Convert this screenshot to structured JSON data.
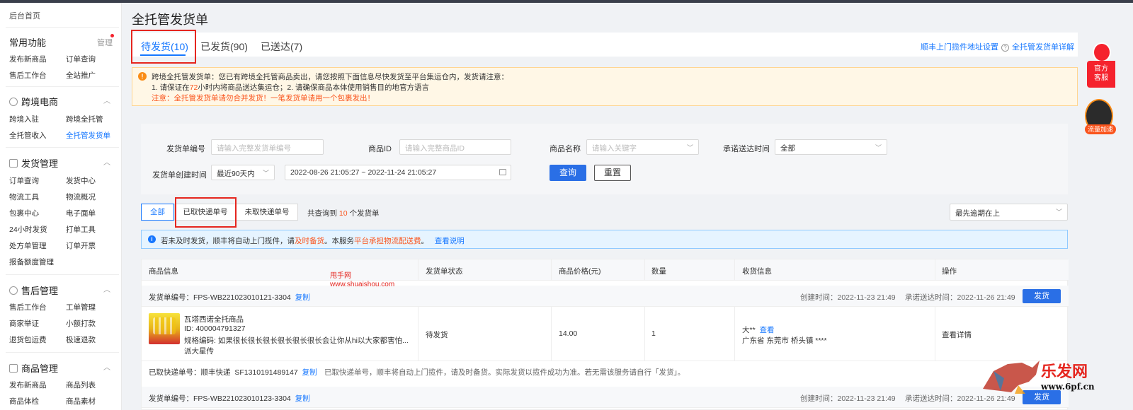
{
  "sidebar": {
    "home": "后台首页",
    "common": {
      "title": "常用功能",
      "manage": "管理",
      "items": [
        "发布新商品",
        "订单查询",
        "售后工作台",
        "全站推广"
      ]
    },
    "crossborder": {
      "title": "跨境电商",
      "items": [
        "跨境入驻",
        "跨境全托管",
        "全托管收入",
        "全托管发货单"
      ]
    },
    "shipping": {
      "title": "发货管理",
      "items": [
        "订单查询",
        "发货中心",
        "物流工具",
        "物流概况",
        "包裹中心",
        "电子面单",
        "24小时发货",
        "打单工具",
        "处方单管理",
        "订单开票",
        "报备额度管理"
      ]
    },
    "aftersale": {
      "title": "售后管理",
      "items": [
        "售后工作台",
        "工单管理",
        "商家举证",
        "小额打款",
        "退货包运费",
        "极速退款"
      ]
    },
    "goods": {
      "title": "商品管理",
      "items": [
        "发布新商品",
        "商品列表",
        "商品体检",
        "商品素材"
      ]
    }
  },
  "page": {
    "title": "全托管发货单",
    "tabs": [
      "待发货(10)",
      "已发货(90)",
      "已送达(7)"
    ],
    "links": [
      "顺丰上门揽件地址设置",
      "全托管发货单详解"
    ]
  },
  "notice": {
    "line1": "跨境全托管发货单：您已有跨境全托管商品卖出，请您按照下面信息尽快发货至平台集运仓内，发货请注意：",
    "line2_a": "1. 请保证在",
    "line2_hours": "72",
    "line2_b": "小时内将商品送达集运仓；2. 请确保商品本体使用销售目的地官方语言",
    "line3": "注意：全托管发货单请勿合并发货！一笔发货单请用一个包裹发出！"
  },
  "filters": {
    "order_no": {
      "label": "发货单编号",
      "placeholder": "请输入完整发货单编号"
    },
    "goods_id": {
      "label": "商品ID",
      "placeholder": "请输入完整商品ID"
    },
    "goods_name": {
      "label": "商品名称",
      "placeholder": "请输入关键字"
    },
    "promise_time": {
      "label": "承诺送达时间",
      "value": "全部"
    },
    "create_time": {
      "label": "发货单创建时间",
      "range_preset": "最近90天内",
      "range": "2022-08-26 21:05:27 ~ 2022-11-24 21:05:27"
    },
    "search": "查询",
    "reset": "重置"
  },
  "segments": [
    "全部",
    "已取快递单号",
    "未取快递单号"
  ],
  "count": {
    "prefix": "共查询到",
    "num": "10",
    "suffix": "个发货单"
  },
  "sort": "最先逾期在上",
  "info_bar": {
    "a": "若未及时发货，顺丰将自动上门揽件，请",
    "b": "及时备货",
    "c": "。本服务",
    "d": "平台承担物流配送费",
    "e": "。",
    "link": "查看说明"
  },
  "table": {
    "headers": [
      "商品信息",
      "发货单状态",
      "商品价格(元)",
      "数量",
      "收货信息",
      "操作"
    ],
    "watermark": [
      "甩手网",
      "www.shuaishou.com"
    ],
    "orders": [
      {
        "no_label": "发货单编号：FPS-WB221023010121-3304",
        "copy": "复制",
        "created": "创建时间：2022-11-23 21:49",
        "promise": "承诺送达时间：2022-11-26 21:49",
        "ship": "发货",
        "goods_name": "瓦塔西诺全托商品",
        "goods_id": "ID: 400004791327",
        "goods_spec": "规格编码: 如果很长很长很长很长很长很长会让你从hi以大家都害怕...",
        "goods_extra": "派大星传",
        "status": "待发货",
        "price": "14.00",
        "qty": "1",
        "receiver": "大**",
        "view": "查看",
        "address": "广东省 东莞市 桥头镇 ****",
        "op": "查看详情",
        "express_label": "已取快递单号：顺丰快递",
        "express_no": "SF1310191489147",
        "express_copy": "复制",
        "express_note": "已取快递单号，顺丰将自动上门揽件，请及时备货。实际发货以揽件成功为准。若无需该服务请自行「发货」。"
      },
      {
        "no_label": "发货单编号：FPS-WB221023010123-3304",
        "copy": "复制",
        "created": "创建时间：2022-11-23 21:49",
        "promise": "承诺送达时间：2022-11-26 21:49",
        "ship": "发货"
      }
    ]
  },
  "floating": {
    "cs": "官方\n客服",
    "flow": "流量加速"
  },
  "brand": {
    "name": "乐发网",
    "url": "www.6pf.cn"
  }
}
